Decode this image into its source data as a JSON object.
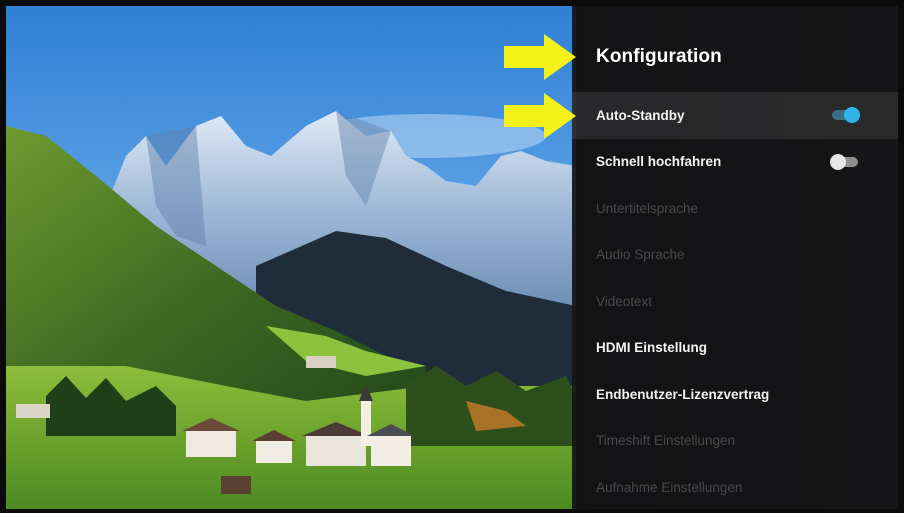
{
  "panel": {
    "title": "Konfiguration",
    "items": [
      {
        "label": "Auto-Standby",
        "state": "enabled",
        "focused": true,
        "toggle": "on"
      },
      {
        "label": "Schnell hochfahren",
        "state": "enabled",
        "focused": false,
        "toggle": "off"
      },
      {
        "label": "Untertitelsprache",
        "state": "disabled",
        "focused": false,
        "toggle": null
      },
      {
        "label": "Audio Sprache",
        "state": "disabled",
        "focused": false,
        "toggle": null
      },
      {
        "label": "Videotext",
        "state": "disabled",
        "focused": false,
        "toggle": null
      },
      {
        "label": "HDMI Einstellung",
        "state": "enabled",
        "focused": false,
        "toggle": null
      },
      {
        "label": "Endbenutzer-Lizenzvertrag",
        "state": "enabled",
        "focused": false,
        "toggle": null
      },
      {
        "label": "Timeshift Einstellungen",
        "state": "disabled",
        "focused": false,
        "toggle": null
      },
      {
        "label": "Aufnahme Einstellungen",
        "state": "disabled",
        "focused": false,
        "toggle": null
      }
    ]
  },
  "colors": {
    "accent": "#2fb3e8",
    "arrow": "#f5f21a",
    "panel_bg": "#161618"
  },
  "icons": {
    "annotation_arrow": "arrow-right-icon"
  }
}
